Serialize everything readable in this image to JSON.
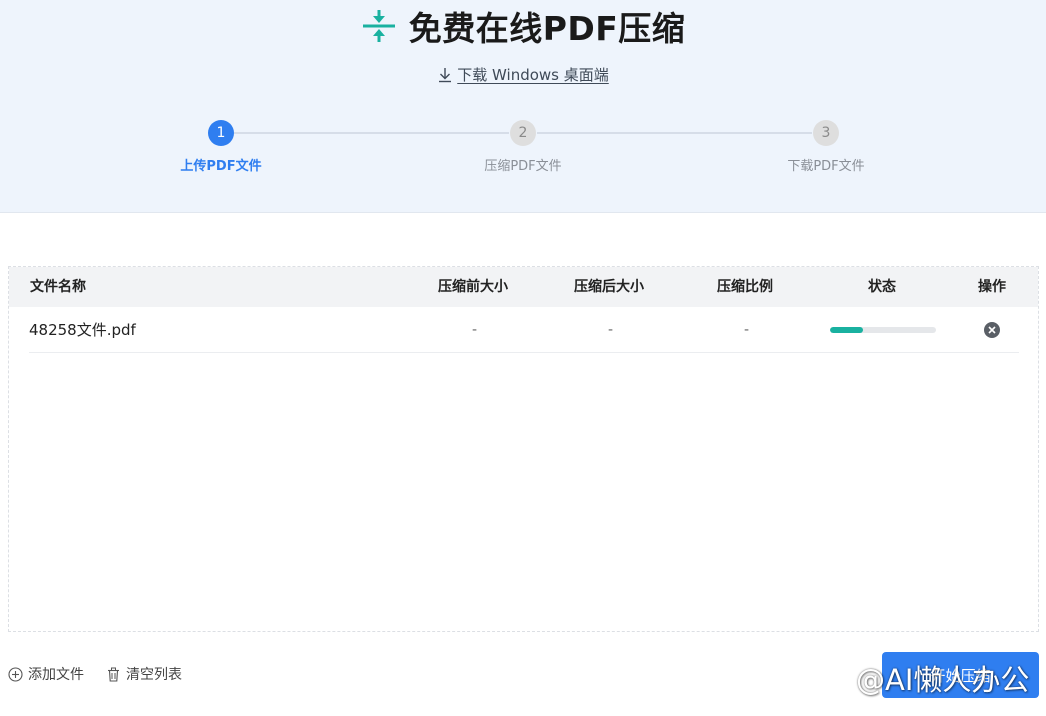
{
  "header": {
    "title": "免费在线PDF压缩",
    "download_link": "下载 Windows 桌面端"
  },
  "steps": [
    {
      "number": "1",
      "label": "上传PDF文件",
      "active": true
    },
    {
      "number": "2",
      "label": "压缩PDF文件",
      "active": false
    },
    {
      "number": "3",
      "label": "下载PDF文件",
      "active": false
    }
  ],
  "table": {
    "columns": {
      "name": "文件名称",
      "before": "压缩前大小",
      "after": "压缩后大小",
      "ratio": "压缩比例",
      "status": "状态",
      "action": "操作"
    },
    "rows": [
      {
        "name": "48258文件.pdf",
        "before": "-",
        "after": "-",
        "ratio": "-",
        "progress": 0.31
      }
    ]
  },
  "footer": {
    "add_file": "添加文件",
    "clear_list": "清空列表",
    "start_button": "开始压缩"
  },
  "watermark": {
    "text": "@AI懒人办公"
  },
  "colors": {
    "accent": "#2f7ef0",
    "progress": "#19b1a0",
    "panel_bg": "#eef4fc"
  },
  "icons": {
    "title_icon": "compress-icon",
    "download_icon": "download-icon",
    "remove_icon": "close-circle-icon",
    "add_icon": "plus-circle-icon",
    "clear_icon": "trash-icon"
  }
}
